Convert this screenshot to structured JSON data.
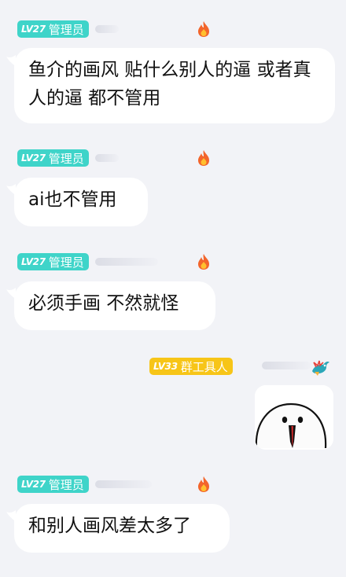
{
  "messages": [
    {
      "level": "LV27",
      "role": "管理员",
      "badge_color": "#3fd4c9",
      "text": "鱼介的画风 贴什么别人的逼 或者真人的逼 都不管用"
    },
    {
      "level": "LV27",
      "role": "管理员",
      "badge_color": "#3fd4c9",
      "text": "ai也不管用"
    },
    {
      "level": "LV27",
      "role": "管理员",
      "badge_color": "#3fd4c9",
      "text": "必须手画 不然就怪"
    },
    {
      "level": "LV33",
      "role": "群工具人",
      "badge_color": "#f7c518",
      "image": "bean-sticker"
    },
    {
      "level": "LV27",
      "role": "管理员",
      "badge_color": "#3fd4c9",
      "text": "和别人画风差太多了"
    }
  ],
  "icons": {
    "admin_flair": "fire-icon",
    "tool_flair": "dragon-icon"
  }
}
